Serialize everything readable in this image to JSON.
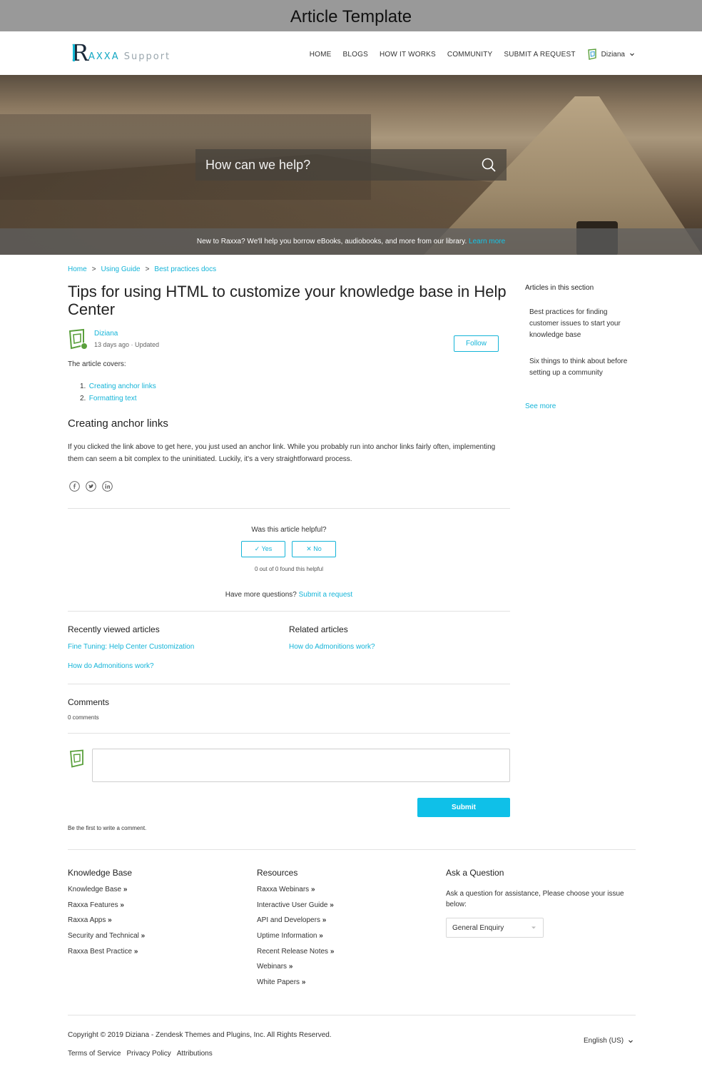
{
  "page_label": "Article Template",
  "header": {
    "logo_initial": "R",
    "logo_brand": "AXXA",
    "logo_suffix": "Support",
    "nav": [
      "HOME",
      "BLOGS",
      "HOW IT WORKS",
      "COMMUNITY",
      "SUBMIT A REQUEST"
    ],
    "user_name": "Diziana"
  },
  "hero": {
    "search_placeholder": "How can we help?",
    "banner_text": "New to Raxxa? We'll help you borrow eBooks, audiobooks, and more from our library.",
    "banner_link": "Learn more"
  },
  "breadcrumb": [
    "Home",
    "Using Guide",
    "Best practices docs"
  ],
  "article": {
    "title": "Tips for using HTML to customize your knowledge base in Help Center",
    "author": "Diziana",
    "meta": "13 days ago · Updated",
    "follow_label": "Follow",
    "covers_intro": "The article covers:",
    "toc": [
      "Creating anchor links",
      "Formatting text"
    ],
    "section_heading": "Creating anchor links",
    "body": "If you clicked the link above to get here, you just used an anchor link. While you probably run into anchor links fairly often, implementing them can seem a bit complex to the uninitiated. Luckily, it's a very straightforward process."
  },
  "vote": {
    "question": "Was this article helpful?",
    "yes_label": "✓  Yes",
    "no_label": "✕  No",
    "count_text": "0 out of 0 found this helpful",
    "more_questions": "Have more questions?",
    "submit_request": "Submit a request"
  },
  "recently_viewed": {
    "title": "Recently viewed articles",
    "items": [
      "Fine Tuning: Help Center Customization",
      "How do Admonitions work?"
    ]
  },
  "related": {
    "title": "Related articles",
    "items": [
      "How do Admonitions work?"
    ]
  },
  "comments": {
    "title": "Comments",
    "count": "0 comments",
    "submit_label": "Submit",
    "first_prompt": "Be the first to write a comment."
  },
  "sidebar": {
    "title": "Articles in this section",
    "items": [
      "Best practices for finding customer issues to start your knowledge base",
      "Six things to think about before setting up a community"
    ],
    "see_more": "See more"
  },
  "footer": {
    "knowledge_base": {
      "title": "Knowledge Base",
      "links": [
        "Knowledge Base",
        "Raxxa Features",
        "Raxxa Apps",
        "Security and Technical",
        "Raxxa Best Practice"
      ]
    },
    "resources": {
      "title": "Resources",
      "links": [
        "Raxxa Webinars",
        "Interactive User Guide",
        "API and Developers",
        "Uptime Information",
        "Recent Release Notes",
        "Webinars",
        "White Papers"
      ]
    },
    "ask": {
      "title": "Ask a Question",
      "text": "Ask a question for assistance, Please choose your issue below:",
      "select_value": "General Enquiry"
    },
    "arrow": "»",
    "copyright": "Copyright © 2019 Diziana - Zendesk Themes and Plugins, Inc. All Rights Reserved.",
    "bottom_links": [
      "Terms of Service",
      "Privacy Policy",
      "Attributions"
    ],
    "language": "English (US)"
  },
  "colors": {
    "accent": "#14b4d8",
    "submit": "#0fc0e8",
    "topbar": "#999999"
  }
}
